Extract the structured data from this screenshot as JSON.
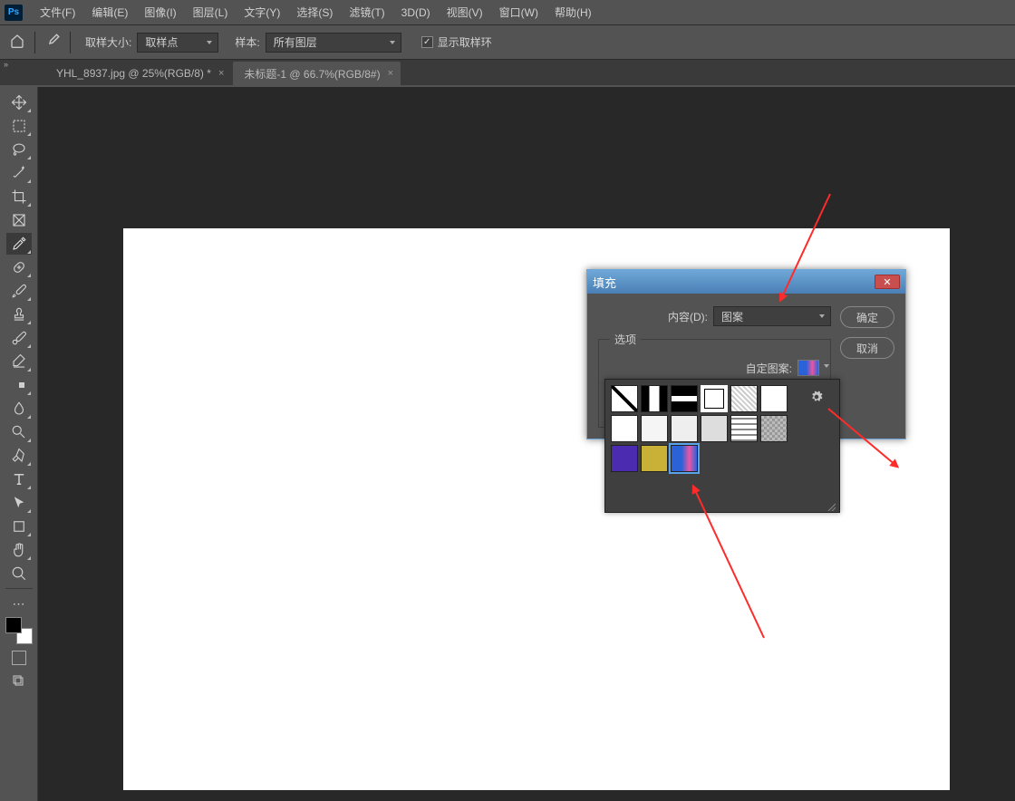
{
  "app": {
    "short": "Ps"
  },
  "menu": {
    "file": "文件(F)",
    "edit": "编辑(E)",
    "image": "图像(I)",
    "layer": "图层(L)",
    "type": "文字(Y)",
    "select": "选择(S)",
    "filter": "滤镜(T)",
    "threed": "3D(D)",
    "view": "视图(V)",
    "window": "窗口(W)",
    "help": "帮助(H)"
  },
  "options": {
    "sample_size_label": "取样大小:",
    "sample_size_value": "取样点",
    "sample_label": "样本:",
    "sample_value": "所有图层",
    "show_ring": "显示取样环"
  },
  "tabs": {
    "t0": {
      "label": "YHL_8937.jpg @ 25%(RGB/8) *"
    },
    "t1": {
      "label": "未标题-1 @ 66.7%(RGB/8#)"
    }
  },
  "dialog": {
    "title": "填充",
    "content_label": "内容(D): ",
    "content_value": "图案",
    "options_label": "选项",
    "custom_pattern_label": "自定图案:",
    "ok": "确定",
    "cancel": "取消"
  },
  "doc_marker": "»"
}
